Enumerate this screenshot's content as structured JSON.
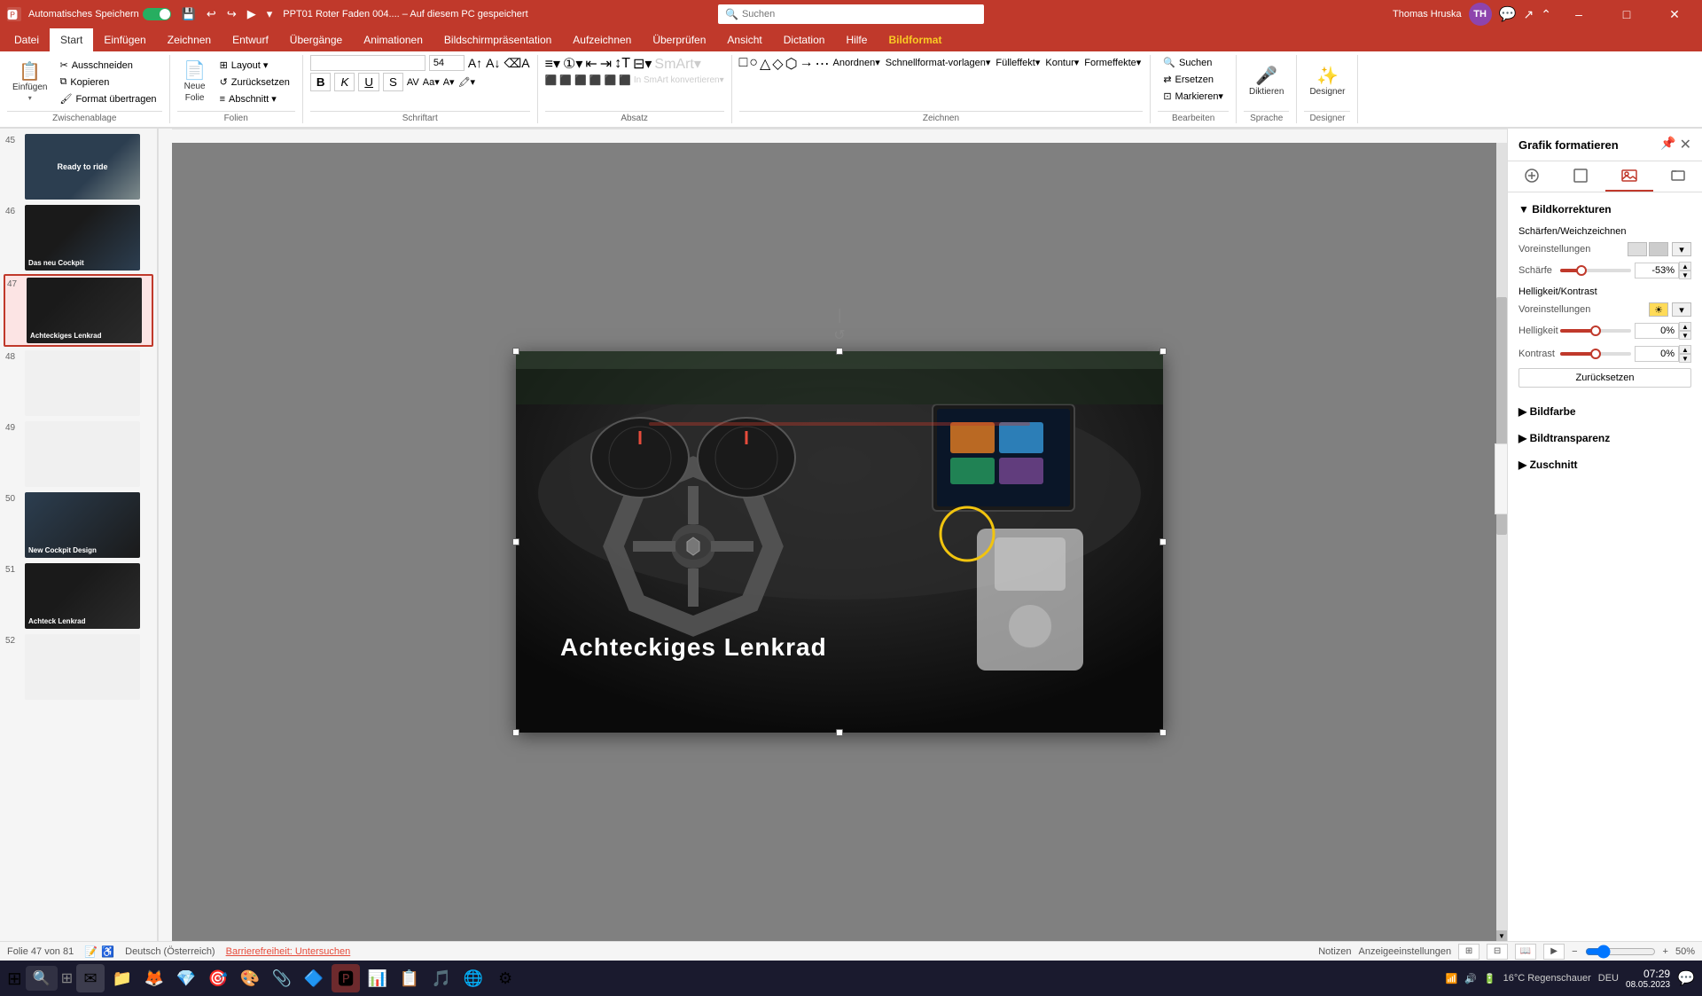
{
  "titlebar": {
    "autosave_label": "Automatisches Speichern",
    "file_name": "PPT01 Roter Faden 004.... – Auf diesem PC gespeichert",
    "user_name": "Thomas Hruska",
    "user_initials": "TH",
    "search_placeholder": "Suchen",
    "window_controls": {
      "minimize": "–",
      "maximize": "□",
      "close": "✕"
    }
  },
  "ribbon": {
    "tabs": [
      "Datei",
      "Start",
      "Einfügen",
      "Zeichnen",
      "Entwurf",
      "Übergänge",
      "Animationen",
      "Bildschirmpräsentation",
      "Aufzeichnen",
      "Überprüfen",
      "Ansicht",
      "Dictation",
      "Hilfe",
      "Bildformat"
    ],
    "active_tab": "Start",
    "active_context_tab": "Bildformat",
    "groups": {
      "zwischenablage": {
        "label": "Zwischenablage",
        "buttons": [
          "Einfügen",
          "Ausschneiden",
          "Kopieren",
          "Format übertragen"
        ]
      },
      "folien": {
        "label": "Folien",
        "buttons": [
          "Neue Folie",
          "Layout",
          "Zurücksetzen",
          "Abschnitt"
        ]
      },
      "schriftart": {
        "label": "Schriftart",
        "font_name": "",
        "font_size": "54",
        "buttons": [
          "B",
          "K",
          "U",
          "S"
        ]
      },
      "absatz": {
        "label": "Absatz"
      },
      "zeichnen": {
        "label": "Zeichnen"
      },
      "bearbeiten": {
        "label": "Bearbeiten",
        "buttons": [
          "Suchen",
          "Ersetzen",
          "Markieren"
        ]
      },
      "sprache": {
        "label": "Sprache",
        "buttons": [
          "Diktieren"
        ]
      },
      "designer": {
        "label": "Designer",
        "buttons": [
          "Designer"
        ]
      }
    }
  },
  "slide_panel": {
    "slides": [
      {
        "number": "45",
        "class": "st45",
        "label": "",
        "active": false
      },
      {
        "number": "46",
        "class": "st46",
        "label": "Das neu Cockpit",
        "active": false
      },
      {
        "number": "47",
        "class": "st47",
        "label": "Achteckiges Lenkrad",
        "active": true
      },
      {
        "number": "48",
        "class": "st48",
        "label": "",
        "active": false
      },
      {
        "number": "49",
        "class": "st49",
        "label": "",
        "active": false
      },
      {
        "number": "50",
        "class": "st50",
        "label": "New Cockpit Design",
        "active": false
      },
      {
        "number": "51",
        "class": "st51",
        "label": "Achteck Lenkrad",
        "active": false
      }
    ]
  },
  "canvas": {
    "slide_text": "Achteckiges Lenkrad",
    "cursor_x": "509",
    "cursor_y": "206"
  },
  "right_panel": {
    "title": "Grafik formatieren",
    "sections": {
      "bildkorrekturen": {
        "label": "Bildkorrekturen",
        "expanded": true,
        "subsections": {
          "schaerfen": {
            "label": "Schärfen/Weichzeichnen",
            "voreinstellungen_label": "Voreinstellungen",
            "schaerfe_label": "Schärfe",
            "schaerfe_value": "-53%",
            "helligkeit_kontrast_label": "Helligkeit/Kontrast",
            "voreinstellungen2_label": "Voreinstellungen",
            "helligkeit_label": "Helligkeit",
            "helligkeit_value": "0%",
            "kontrast_label": "Kontrast",
            "kontrast_value": "0%",
            "reset_btn_label": "Zurücksetzen"
          }
        }
      },
      "bildfarbe": {
        "label": "Bildfarbe",
        "expanded": false
      },
      "bildtransparenz": {
        "label": "Bildtransparenz",
        "expanded": false
      },
      "zuschnitt": {
        "label": "Zuschnitt",
        "expanded": false
      }
    }
  },
  "status_bar": {
    "slide_info": "Folie 47 von 81",
    "language": "Deutsch (Österreich)",
    "accessibility": "Barrierefreiheit: Untersuchen",
    "notes": "Notizen",
    "display_settings": "Anzeigeeinstellungen",
    "zoom_value": "50%"
  },
  "taskbar": {
    "icons": [
      "⊞",
      "🔍",
      "✉",
      "📁",
      "🦊",
      "💎",
      "🎯",
      "🎨",
      "📎",
      "🔷",
      "📊",
      "📋",
      "🎵",
      "🌐",
      "⚙"
    ],
    "time": "07:29",
    "date": "08.05.2023",
    "temp": "16°C Regenschauer",
    "language": "DEU"
  }
}
